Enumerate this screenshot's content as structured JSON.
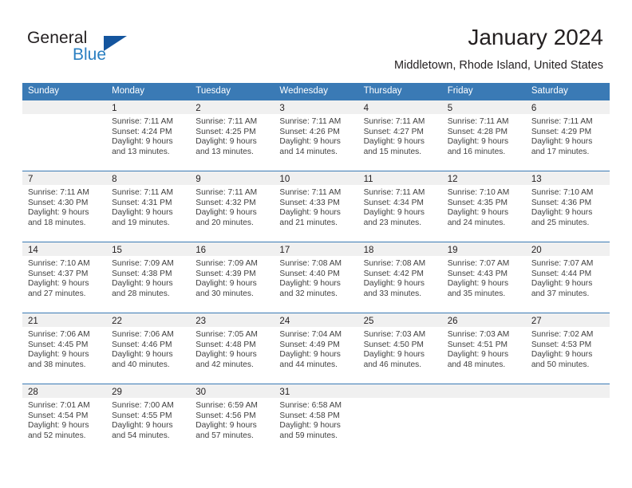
{
  "brand": {
    "name_part1": "General",
    "name_part2": "Blue",
    "flag_icon": "triangle-flag-icon",
    "flag_color": "#14559e",
    "blue_color": "#2a7fc1"
  },
  "header": {
    "title": "January 2024",
    "subtitle": "Middletown, Rhode Island, United States"
  },
  "theme": {
    "header_blue": "#3a7ab5",
    "day_band_gray": "#f0f0f0",
    "text_color": "#231f20",
    "body_text_color": "#404040"
  },
  "weekdays": [
    "Sunday",
    "Monday",
    "Tuesday",
    "Wednesday",
    "Thursday",
    "Friday",
    "Saturday"
  ],
  "weeks": [
    [
      {
        "day": "",
        "empty": true,
        "lines": []
      },
      {
        "day": "1",
        "empty": false,
        "lines": [
          "Sunrise: 7:11 AM",
          "Sunset: 4:24 PM",
          "Daylight: 9 hours",
          "and 13 minutes."
        ]
      },
      {
        "day": "2",
        "empty": false,
        "lines": [
          "Sunrise: 7:11 AM",
          "Sunset: 4:25 PM",
          "Daylight: 9 hours",
          "and 13 minutes."
        ]
      },
      {
        "day": "3",
        "empty": false,
        "lines": [
          "Sunrise: 7:11 AM",
          "Sunset: 4:26 PM",
          "Daylight: 9 hours",
          "and 14 minutes."
        ]
      },
      {
        "day": "4",
        "empty": false,
        "lines": [
          "Sunrise: 7:11 AM",
          "Sunset: 4:27 PM",
          "Daylight: 9 hours",
          "and 15 minutes."
        ]
      },
      {
        "day": "5",
        "empty": false,
        "lines": [
          "Sunrise: 7:11 AM",
          "Sunset: 4:28 PM",
          "Daylight: 9 hours",
          "and 16 minutes."
        ]
      },
      {
        "day": "6",
        "empty": false,
        "lines": [
          "Sunrise: 7:11 AM",
          "Sunset: 4:29 PM",
          "Daylight: 9 hours",
          "and 17 minutes."
        ]
      }
    ],
    [
      {
        "day": "7",
        "empty": false,
        "lines": [
          "Sunrise: 7:11 AM",
          "Sunset: 4:30 PM",
          "Daylight: 9 hours",
          "and 18 minutes."
        ]
      },
      {
        "day": "8",
        "empty": false,
        "lines": [
          "Sunrise: 7:11 AM",
          "Sunset: 4:31 PM",
          "Daylight: 9 hours",
          "and 19 minutes."
        ]
      },
      {
        "day": "9",
        "empty": false,
        "lines": [
          "Sunrise: 7:11 AM",
          "Sunset: 4:32 PM",
          "Daylight: 9 hours",
          "and 20 minutes."
        ]
      },
      {
        "day": "10",
        "empty": false,
        "lines": [
          "Sunrise: 7:11 AM",
          "Sunset: 4:33 PM",
          "Daylight: 9 hours",
          "and 21 minutes."
        ]
      },
      {
        "day": "11",
        "empty": false,
        "lines": [
          "Sunrise: 7:11 AM",
          "Sunset: 4:34 PM",
          "Daylight: 9 hours",
          "and 23 minutes."
        ]
      },
      {
        "day": "12",
        "empty": false,
        "lines": [
          "Sunrise: 7:10 AM",
          "Sunset: 4:35 PM",
          "Daylight: 9 hours",
          "and 24 minutes."
        ]
      },
      {
        "day": "13",
        "empty": false,
        "lines": [
          "Sunrise: 7:10 AM",
          "Sunset: 4:36 PM",
          "Daylight: 9 hours",
          "and 25 minutes."
        ]
      }
    ],
    [
      {
        "day": "14",
        "empty": false,
        "lines": [
          "Sunrise: 7:10 AM",
          "Sunset: 4:37 PM",
          "Daylight: 9 hours",
          "and 27 minutes."
        ]
      },
      {
        "day": "15",
        "empty": false,
        "lines": [
          "Sunrise: 7:09 AM",
          "Sunset: 4:38 PM",
          "Daylight: 9 hours",
          "and 28 minutes."
        ]
      },
      {
        "day": "16",
        "empty": false,
        "lines": [
          "Sunrise: 7:09 AM",
          "Sunset: 4:39 PM",
          "Daylight: 9 hours",
          "and 30 minutes."
        ]
      },
      {
        "day": "17",
        "empty": false,
        "lines": [
          "Sunrise: 7:08 AM",
          "Sunset: 4:40 PM",
          "Daylight: 9 hours",
          "and 32 minutes."
        ]
      },
      {
        "day": "18",
        "empty": false,
        "lines": [
          "Sunrise: 7:08 AM",
          "Sunset: 4:42 PM",
          "Daylight: 9 hours",
          "and 33 minutes."
        ]
      },
      {
        "day": "19",
        "empty": false,
        "lines": [
          "Sunrise: 7:07 AM",
          "Sunset: 4:43 PM",
          "Daylight: 9 hours",
          "and 35 minutes."
        ]
      },
      {
        "day": "20",
        "empty": false,
        "lines": [
          "Sunrise: 7:07 AM",
          "Sunset: 4:44 PM",
          "Daylight: 9 hours",
          "and 37 minutes."
        ]
      }
    ],
    [
      {
        "day": "21",
        "empty": false,
        "lines": [
          "Sunrise: 7:06 AM",
          "Sunset: 4:45 PM",
          "Daylight: 9 hours",
          "and 38 minutes."
        ]
      },
      {
        "day": "22",
        "empty": false,
        "lines": [
          "Sunrise: 7:06 AM",
          "Sunset: 4:46 PM",
          "Daylight: 9 hours",
          "and 40 minutes."
        ]
      },
      {
        "day": "23",
        "empty": false,
        "lines": [
          "Sunrise: 7:05 AM",
          "Sunset: 4:48 PM",
          "Daylight: 9 hours",
          "and 42 minutes."
        ]
      },
      {
        "day": "24",
        "empty": false,
        "lines": [
          "Sunrise: 7:04 AM",
          "Sunset: 4:49 PM",
          "Daylight: 9 hours",
          "and 44 minutes."
        ]
      },
      {
        "day": "25",
        "empty": false,
        "lines": [
          "Sunrise: 7:03 AM",
          "Sunset: 4:50 PM",
          "Daylight: 9 hours",
          "and 46 minutes."
        ]
      },
      {
        "day": "26",
        "empty": false,
        "lines": [
          "Sunrise: 7:03 AM",
          "Sunset: 4:51 PM",
          "Daylight: 9 hours",
          "and 48 minutes."
        ]
      },
      {
        "day": "27",
        "empty": false,
        "lines": [
          "Sunrise: 7:02 AM",
          "Sunset: 4:53 PM",
          "Daylight: 9 hours",
          "and 50 minutes."
        ]
      }
    ],
    [
      {
        "day": "28",
        "empty": false,
        "lines": [
          "Sunrise: 7:01 AM",
          "Sunset: 4:54 PM",
          "Daylight: 9 hours",
          "and 52 minutes."
        ]
      },
      {
        "day": "29",
        "empty": false,
        "lines": [
          "Sunrise: 7:00 AM",
          "Sunset: 4:55 PM",
          "Daylight: 9 hours",
          "and 54 minutes."
        ]
      },
      {
        "day": "30",
        "empty": false,
        "lines": [
          "Sunrise: 6:59 AM",
          "Sunset: 4:56 PM",
          "Daylight: 9 hours",
          "and 57 minutes."
        ]
      },
      {
        "day": "31",
        "empty": false,
        "lines": [
          "Sunrise: 6:58 AM",
          "Sunset: 4:58 PM",
          "Daylight: 9 hours",
          "and 59 minutes."
        ]
      },
      {
        "day": "",
        "empty": true,
        "lines": []
      },
      {
        "day": "",
        "empty": true,
        "lines": []
      },
      {
        "day": "",
        "empty": true,
        "lines": []
      }
    ]
  ]
}
